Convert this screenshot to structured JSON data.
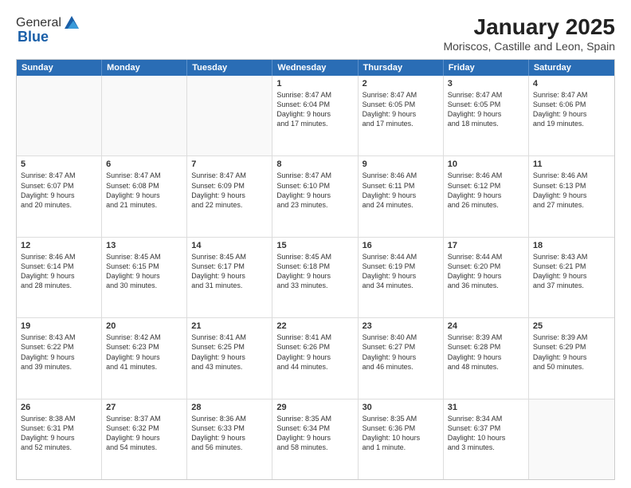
{
  "logo": {
    "general": "General",
    "blue": "Blue"
  },
  "title": "January 2025",
  "subtitle": "Moriscos, Castille and Leon, Spain",
  "header_days": [
    "Sunday",
    "Monday",
    "Tuesday",
    "Wednesday",
    "Thursday",
    "Friday",
    "Saturday"
  ],
  "rows": [
    [
      {
        "num": "",
        "text": "",
        "empty": true
      },
      {
        "num": "",
        "text": "",
        "empty": true
      },
      {
        "num": "",
        "text": "",
        "empty": true
      },
      {
        "num": "1",
        "text": "Sunrise: 8:47 AM\nSunset: 6:04 PM\nDaylight: 9 hours\nand 17 minutes."
      },
      {
        "num": "2",
        "text": "Sunrise: 8:47 AM\nSunset: 6:05 PM\nDaylight: 9 hours\nand 17 minutes."
      },
      {
        "num": "3",
        "text": "Sunrise: 8:47 AM\nSunset: 6:05 PM\nDaylight: 9 hours\nand 18 minutes."
      },
      {
        "num": "4",
        "text": "Sunrise: 8:47 AM\nSunset: 6:06 PM\nDaylight: 9 hours\nand 19 minutes."
      }
    ],
    [
      {
        "num": "5",
        "text": "Sunrise: 8:47 AM\nSunset: 6:07 PM\nDaylight: 9 hours\nand 20 minutes."
      },
      {
        "num": "6",
        "text": "Sunrise: 8:47 AM\nSunset: 6:08 PM\nDaylight: 9 hours\nand 21 minutes."
      },
      {
        "num": "7",
        "text": "Sunrise: 8:47 AM\nSunset: 6:09 PM\nDaylight: 9 hours\nand 22 minutes."
      },
      {
        "num": "8",
        "text": "Sunrise: 8:47 AM\nSunset: 6:10 PM\nDaylight: 9 hours\nand 23 minutes."
      },
      {
        "num": "9",
        "text": "Sunrise: 8:46 AM\nSunset: 6:11 PM\nDaylight: 9 hours\nand 24 minutes."
      },
      {
        "num": "10",
        "text": "Sunrise: 8:46 AM\nSunset: 6:12 PM\nDaylight: 9 hours\nand 26 minutes."
      },
      {
        "num": "11",
        "text": "Sunrise: 8:46 AM\nSunset: 6:13 PM\nDaylight: 9 hours\nand 27 minutes."
      }
    ],
    [
      {
        "num": "12",
        "text": "Sunrise: 8:46 AM\nSunset: 6:14 PM\nDaylight: 9 hours\nand 28 minutes."
      },
      {
        "num": "13",
        "text": "Sunrise: 8:45 AM\nSunset: 6:15 PM\nDaylight: 9 hours\nand 30 minutes."
      },
      {
        "num": "14",
        "text": "Sunrise: 8:45 AM\nSunset: 6:17 PM\nDaylight: 9 hours\nand 31 minutes."
      },
      {
        "num": "15",
        "text": "Sunrise: 8:45 AM\nSunset: 6:18 PM\nDaylight: 9 hours\nand 33 minutes."
      },
      {
        "num": "16",
        "text": "Sunrise: 8:44 AM\nSunset: 6:19 PM\nDaylight: 9 hours\nand 34 minutes."
      },
      {
        "num": "17",
        "text": "Sunrise: 8:44 AM\nSunset: 6:20 PM\nDaylight: 9 hours\nand 36 minutes."
      },
      {
        "num": "18",
        "text": "Sunrise: 8:43 AM\nSunset: 6:21 PM\nDaylight: 9 hours\nand 37 minutes."
      }
    ],
    [
      {
        "num": "19",
        "text": "Sunrise: 8:43 AM\nSunset: 6:22 PM\nDaylight: 9 hours\nand 39 minutes."
      },
      {
        "num": "20",
        "text": "Sunrise: 8:42 AM\nSunset: 6:23 PM\nDaylight: 9 hours\nand 41 minutes."
      },
      {
        "num": "21",
        "text": "Sunrise: 8:41 AM\nSunset: 6:25 PM\nDaylight: 9 hours\nand 43 minutes."
      },
      {
        "num": "22",
        "text": "Sunrise: 8:41 AM\nSunset: 6:26 PM\nDaylight: 9 hours\nand 44 minutes."
      },
      {
        "num": "23",
        "text": "Sunrise: 8:40 AM\nSunset: 6:27 PM\nDaylight: 9 hours\nand 46 minutes."
      },
      {
        "num": "24",
        "text": "Sunrise: 8:39 AM\nSunset: 6:28 PM\nDaylight: 9 hours\nand 48 minutes."
      },
      {
        "num": "25",
        "text": "Sunrise: 8:39 AM\nSunset: 6:29 PM\nDaylight: 9 hours\nand 50 minutes."
      }
    ],
    [
      {
        "num": "26",
        "text": "Sunrise: 8:38 AM\nSunset: 6:31 PM\nDaylight: 9 hours\nand 52 minutes."
      },
      {
        "num": "27",
        "text": "Sunrise: 8:37 AM\nSunset: 6:32 PM\nDaylight: 9 hours\nand 54 minutes."
      },
      {
        "num": "28",
        "text": "Sunrise: 8:36 AM\nSunset: 6:33 PM\nDaylight: 9 hours\nand 56 minutes."
      },
      {
        "num": "29",
        "text": "Sunrise: 8:35 AM\nSunset: 6:34 PM\nDaylight: 9 hours\nand 58 minutes."
      },
      {
        "num": "30",
        "text": "Sunrise: 8:35 AM\nSunset: 6:36 PM\nDaylight: 10 hours\nand 1 minute."
      },
      {
        "num": "31",
        "text": "Sunrise: 8:34 AM\nSunset: 6:37 PM\nDaylight: 10 hours\nand 3 minutes."
      },
      {
        "num": "",
        "text": "",
        "empty": true
      }
    ]
  ]
}
